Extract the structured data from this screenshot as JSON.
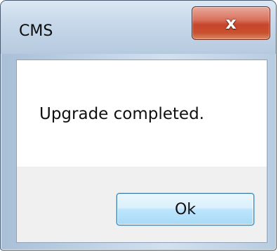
{
  "window": {
    "title": "CMS",
    "close_icon": "close-icon",
    "close_glyph": "x"
  },
  "dialog": {
    "message": "Upgrade completed.",
    "ok_label": "Ok"
  },
  "colors": {
    "close_button": "#c7452c",
    "ok_button_border": "#3c7fb1",
    "frame": "#b8cce0"
  }
}
